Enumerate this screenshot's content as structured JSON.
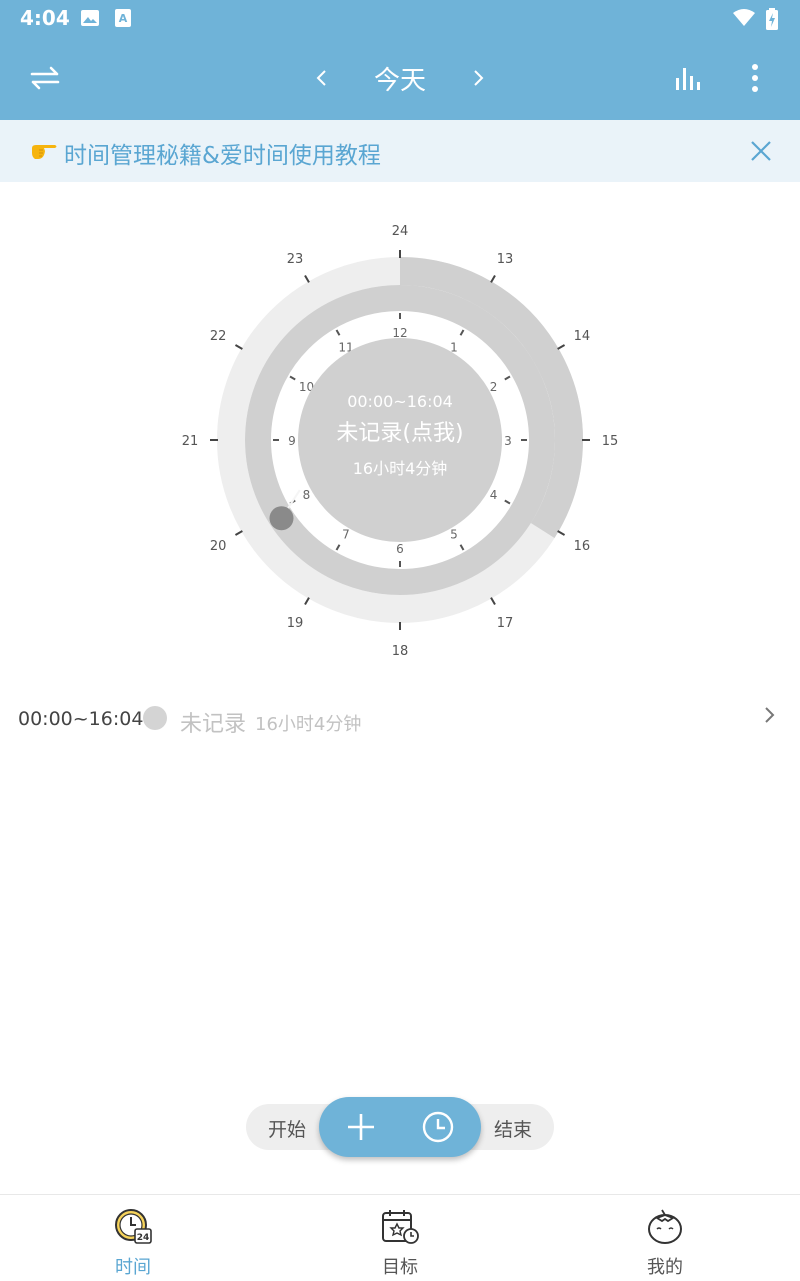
{
  "status_bar": {
    "time": "4:04"
  },
  "app_bar": {
    "title": "今天",
    "prev_label": "‹",
    "next_label": "›"
  },
  "banner": {
    "emoji": "👉",
    "text": "时间管理秘籍&爱时间使用教程"
  },
  "dial": {
    "outer_hours": [
      "24",
      "13",
      "14",
      "15",
      "16",
      "17",
      "18",
      "19",
      "20",
      "21",
      "22",
      "23"
    ],
    "inner_hours": [
      "12",
      "1",
      "2",
      "3",
      "4",
      "5",
      "6",
      "7",
      "8",
      "9",
      "10",
      "11"
    ],
    "center_range": "00:00~16:04",
    "center_label": "未记录(点我)",
    "center_duration": "16小时4分钟",
    "recorded_fraction": 0.67,
    "colors": {
      "filled": "#d0d0d0",
      "empty": "#eeeeee",
      "marker": "#8a8a8a"
    }
  },
  "record": {
    "range": "00:00~16:04",
    "label": "未记录",
    "duration": "16小时4分钟"
  },
  "actions": {
    "start_label": "开始",
    "end_label": "结束"
  },
  "bottom_nav": {
    "items": [
      {
        "label": "时间",
        "icon": "clock-24-icon",
        "active": true
      },
      {
        "label": "目标",
        "icon": "calendar-target-icon",
        "active": false
      },
      {
        "label": "我的",
        "icon": "tomato-icon",
        "active": false
      }
    ]
  },
  "theme": {
    "primary": "#6fb3d8",
    "accent_text": "#5aa6d2"
  }
}
